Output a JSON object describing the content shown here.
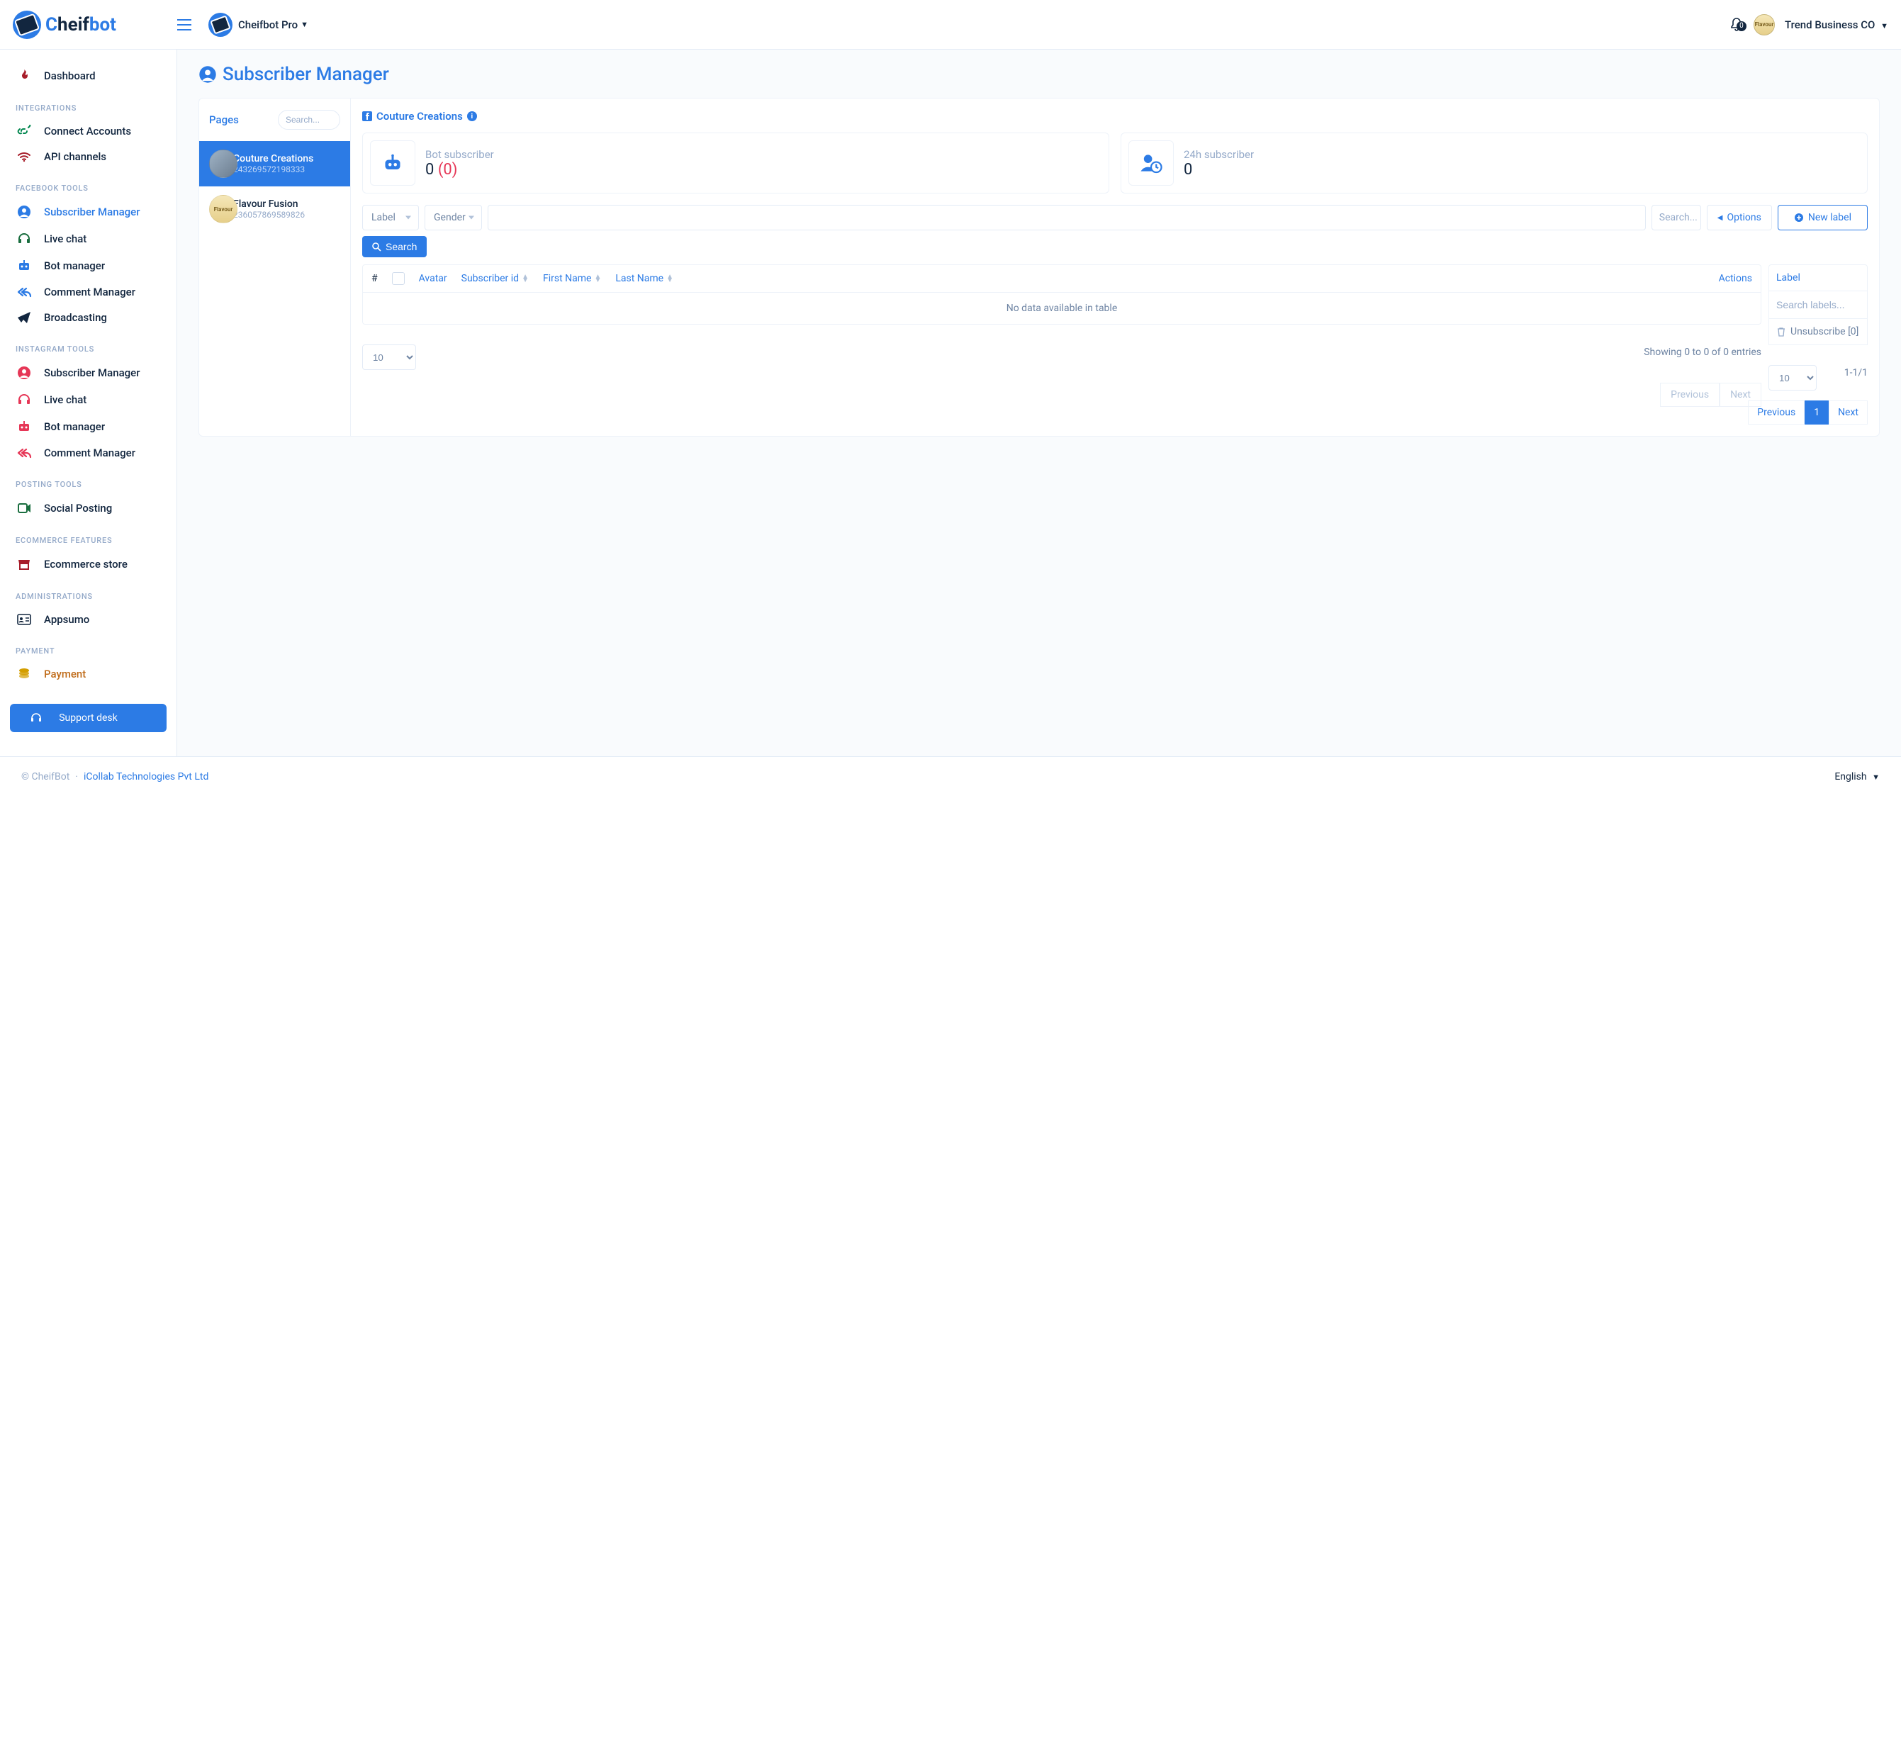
{
  "brand": {
    "prefix": "C",
    "mid": "heif",
    "suffix": "bot"
  },
  "topbar": {
    "product": "Cheifbot Pro",
    "notif_count": "0",
    "account": "Trend Business CO"
  },
  "sidebar": {
    "dashboard": "Dashboard",
    "sec_integrations": "INTEGRATIONS",
    "connect_accounts": "Connect Accounts",
    "api_channels": "API channels",
    "sec_facebook": "FACEBOOK TOOLS",
    "fb_subscriber_manager": "Subscriber Manager",
    "fb_live_chat": "Live chat",
    "fb_bot_manager": "Bot manager",
    "fb_comment_manager": "Comment Manager",
    "fb_broadcasting": "Broadcasting",
    "sec_instagram": "INSTAGRAM TOOLS",
    "ig_subscriber_manager": "Subscriber Manager",
    "ig_live_chat": "Live chat",
    "ig_bot_manager": "Bot manager",
    "ig_comment_manager": "Comment Manager",
    "sec_posting": "POSTING TOOLS",
    "social_posting": "Social Posting",
    "sec_ecom": "ECOMMERCE FEATURES",
    "ecom_store": "Ecommerce store",
    "sec_admin": "ADMINISTRATIONS",
    "appsumo": "Appsumo",
    "sec_payment": "PAYMENT",
    "payment": "Payment",
    "support": "Support desk"
  },
  "page": {
    "title": "Subscriber Manager"
  },
  "pages_panel": {
    "header": "Pages",
    "search_placeholder": "Search...",
    "items": [
      {
        "name": "Couture Creations",
        "id": "243269572198333"
      },
      {
        "name": "Flavour Fusion",
        "id": "236057869589826"
      }
    ]
  },
  "content": {
    "page_name": "Couture Creations",
    "stat1_label": "Bot subscriber",
    "stat1_val": "0",
    "stat1_extra": "(0)",
    "stat2_label": "24h subscriber",
    "stat2_val": "0",
    "filter_label": "Label",
    "filter_gender": "Gender",
    "search_placeholder": "Search...",
    "options": "Options",
    "new_label": "New label",
    "search_btn": "Search",
    "cols": {
      "hash": "#",
      "avatar": "Avatar",
      "sid": "Subscriber id",
      "fn": "First Name",
      "ln": "Last Name",
      "actions": "Actions"
    },
    "empty": "No data available in table",
    "page_size": "10",
    "entries": "Showing 0 to 0 of 0 entries",
    "prev": "Previous",
    "next": "Next"
  },
  "labels_panel": {
    "header": "Label",
    "search_placeholder": "Search labels...",
    "unsubscribe": "Unsubscribe [0]",
    "page_size": "10",
    "range": "1-1/1",
    "prev": "Previous",
    "page1": "1",
    "next": "Next"
  },
  "footer": {
    "copyright": "© CheifBot",
    "sep": "·",
    "company": "iCollab Technologies Pvt Ltd",
    "lang": "English"
  }
}
